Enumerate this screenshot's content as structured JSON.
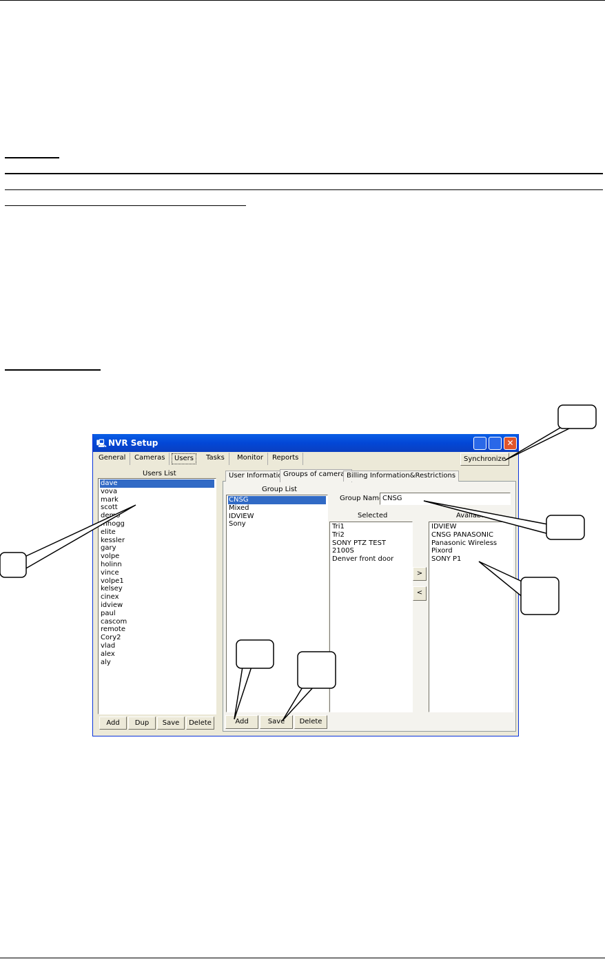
{
  "window": {
    "title": "NVR Setup",
    "tabs": [
      "General",
      "Cameras",
      "Users",
      "Tasks",
      "Monitor",
      "Reports"
    ],
    "active_tab": "Users",
    "synchronize": "Synchronize"
  },
  "users": {
    "label": "Users List",
    "items": [
      "dave",
      "vova",
      "mark",
      "scott",
      "demo",
      "mhogg",
      "elite",
      "kessler",
      "gary",
      "volpe",
      "holinn",
      "vince",
      "volpe1",
      "kelsey",
      "cinex",
      "idview",
      "paul",
      "cascom",
      "remote",
      "Cory2",
      "vlad",
      "alex",
      "aly"
    ],
    "selected": "dave",
    "buttons": [
      "Add",
      "Dup",
      "Save",
      "Delete"
    ]
  },
  "subtabs": [
    "User Information",
    "Groups of cameras",
    "Billing Information&Restrictions"
  ],
  "groups": {
    "label": "Group List",
    "items": [
      "CNSG",
      "Mixed",
      "IDVIEW",
      "Sony"
    ],
    "selected": "CNSG",
    "buttons": [
      "Add",
      "Save",
      "Delete"
    ],
    "name_label": "Group Name",
    "name_value": "CNSG",
    "selected_label": "Selected",
    "selected_items": [
      "Tri1",
      "Tri2",
      "SONY PTZ TEST",
      "2100S",
      "Denver front door"
    ],
    "available_label": "Available",
    "available_items": [
      "IDVIEW",
      "CNSG PANASONIC",
      "Panasonic Wireless",
      "Pixord",
      "SONY P1"
    ],
    "move_right": ">",
    "move_left": "<"
  }
}
